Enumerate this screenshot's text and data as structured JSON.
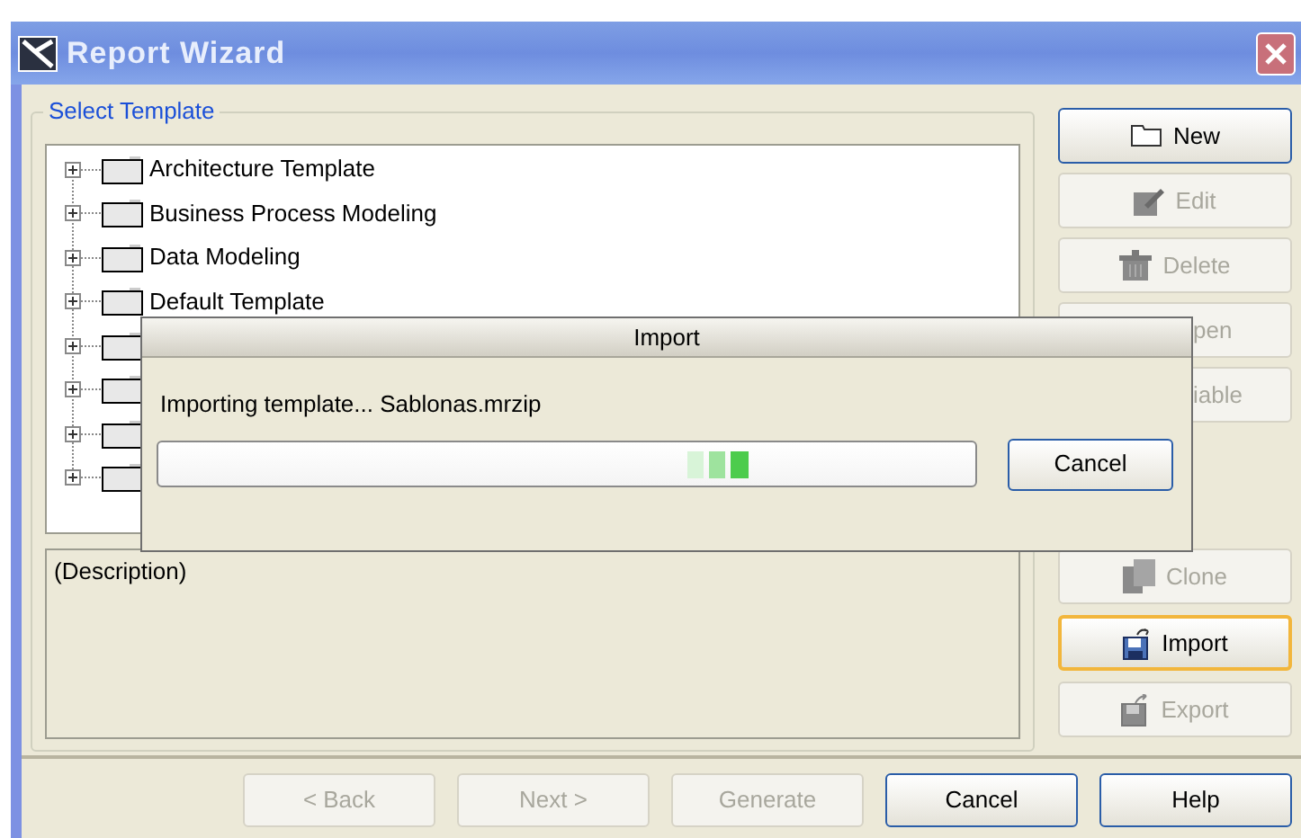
{
  "window": {
    "title": "Report Wizard"
  },
  "group": {
    "label": "Select Template"
  },
  "tree": [
    {
      "label": "Architecture Template",
      "expanded": false
    },
    {
      "label": "Business Process Modeling",
      "expanded": false
    },
    {
      "label": "Data Modeling",
      "expanded": false
    },
    {
      "label": "Default Template",
      "expanded": false
    },
    {
      "expanded": false
    },
    {
      "expanded": false
    },
    {
      "expanded": false
    },
    {
      "expanded": false
    }
  ],
  "description": "(Description)",
  "side_buttons_top": [
    {
      "label": "New",
      "kind": "folder",
      "disabled": false,
      "focused": false,
      "clipped": false
    },
    {
      "label": "Edit",
      "kind": "edit",
      "disabled": true,
      "focused": false,
      "clipped": false
    },
    {
      "label": "Delete",
      "kind": "trash",
      "disabled": true,
      "focused": false,
      "clipped": false
    },
    {
      "label": "pen",
      "disabled": true,
      "focused": false,
      "clipped": true
    },
    {
      "label": "iable",
      "disabled": true,
      "focused": false,
      "clipped": true
    }
  ],
  "side_buttons_bottom": [
    {
      "label": "Clone",
      "kind": "clone",
      "disabled": true,
      "focused": false,
      "clipped": false
    },
    {
      "label": "Import",
      "kind": "import",
      "disabled": false,
      "focused": true,
      "clipped": false
    },
    {
      "label": "Export",
      "kind": "export",
      "disabled": true,
      "focused": false,
      "clipped": false
    }
  ],
  "footer_buttons": [
    {
      "label": "< Back",
      "disabled": true
    },
    {
      "label": "Next >",
      "disabled": true
    },
    {
      "label": "Generate",
      "disabled": true
    },
    {
      "label": "Cancel",
      "disabled": false
    },
    {
      "label": "Help",
      "disabled": false
    }
  ],
  "dialog": {
    "title": "Import",
    "message": "Importing template... Sablonas.mrzip",
    "button": "Cancel"
  }
}
